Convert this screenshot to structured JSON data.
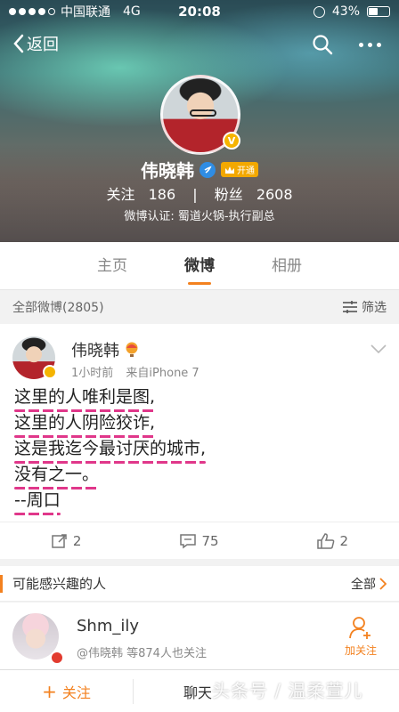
{
  "status_bar": {
    "carrier": "中国联通",
    "network": "4G",
    "time": "20:08",
    "battery": "43%"
  },
  "nav": {
    "back_label": "返回"
  },
  "profile": {
    "name": "伟晓韩",
    "vip_badge": "开通",
    "following_label": "关注",
    "following_count": "186",
    "followers_label": "粉丝",
    "followers_count": "2608",
    "verification": "微博认证: 蜀道火锅-执行副总"
  },
  "tabs": [
    {
      "label": "主页",
      "active": false
    },
    {
      "label": "微博",
      "active": true
    },
    {
      "label": "相册",
      "active": false
    }
  ],
  "feed_header": {
    "title": "全部微博(2805)",
    "filter_label": "筛选"
  },
  "post": {
    "author": "伟晓韩",
    "time": "1小时前",
    "source": "来自iPhone 7",
    "lines": [
      "这里的人唯利是图,",
      "这里的人阴险狡诈,",
      "这是我迄今最讨厌的城市,",
      "没有之一。",
      "--周口"
    ],
    "reposts": "2",
    "comments": "75",
    "likes": "2"
  },
  "suggest": {
    "title": "可能感兴趣的人",
    "all_label": "全部",
    "user": {
      "name": "Shm_ily",
      "desc": "@伟晓韩 等874人也关注",
      "action": "加关注"
    }
  },
  "bottom_bar": {
    "follow_label": "关注",
    "chat_label": "聊天"
  },
  "watermark": "头条号 / 温柔萱儿",
  "colors": {
    "accent": "#f3811f",
    "verify_blue": "#2f8de4",
    "underline_pink": "#e0378a"
  }
}
